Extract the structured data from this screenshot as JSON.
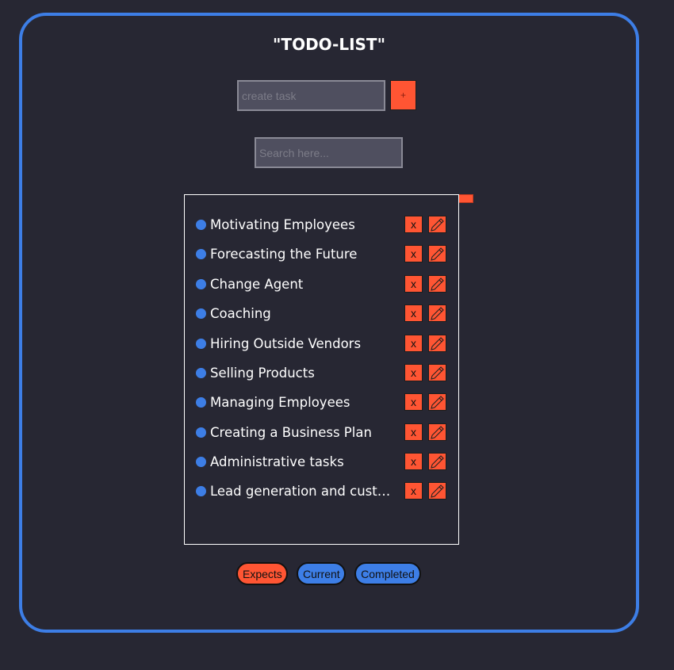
{
  "app": {
    "title": "\"TODO-LIST\""
  },
  "create": {
    "placeholder": "create task",
    "add_label": "+"
  },
  "search": {
    "placeholder": "Search here..."
  },
  "tasks": [
    {
      "label": "Motivating Employees",
      "delete_label": "x"
    },
    {
      "label": "Forecasting the Future",
      "delete_label": "x"
    },
    {
      "label": "Change Agent",
      "delete_label": "x"
    },
    {
      "label": "Coaching",
      "delete_label": "x"
    },
    {
      "label": "Hiring Outside Vendors",
      "delete_label": "x"
    },
    {
      "label": "Selling Products",
      "delete_label": "x"
    },
    {
      "label": "Managing Employees",
      "delete_label": "x"
    },
    {
      "label": "Creating a Business Plan",
      "delete_label": "x"
    },
    {
      "label": "Administrative tasks",
      "delete_label": "x"
    },
    {
      "label": "Lead generation and customer follow-up",
      "delete_label": "x"
    }
  ],
  "filters": {
    "expects": "Expects",
    "current": "Current",
    "completed": "Completed"
  },
  "colors": {
    "background": "#272733",
    "accent_blue": "#3d7ee6",
    "accent_red": "#ff5533"
  },
  "icons": {
    "task_status": "dot-icon",
    "edit": "pencil-icon"
  }
}
